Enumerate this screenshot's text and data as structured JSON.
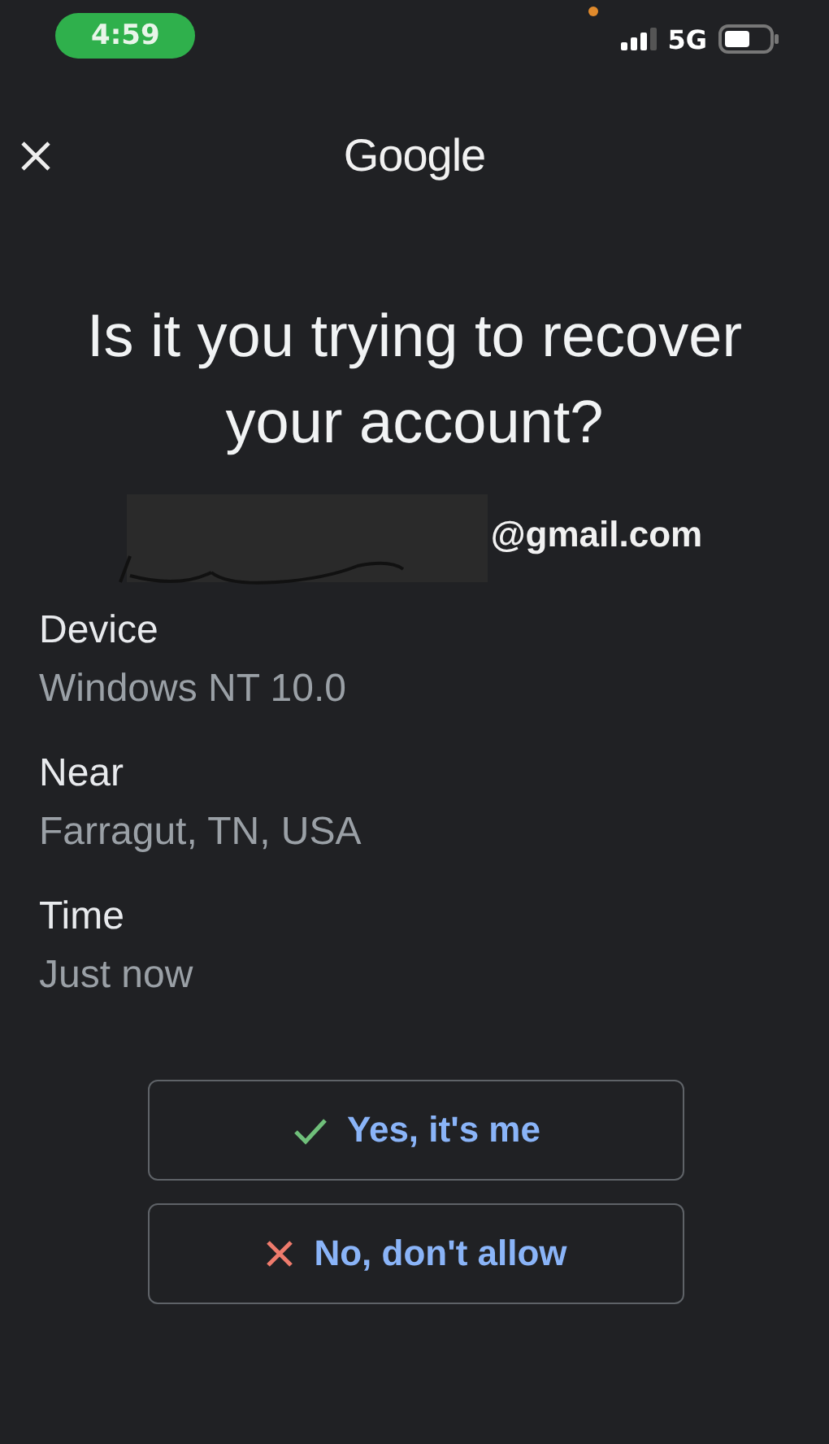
{
  "status_bar": {
    "time": "4:59",
    "network": "5G"
  },
  "header": {
    "title": "Google"
  },
  "heading": "Is it you trying to recover your account?",
  "account": {
    "email": "@gmail.com"
  },
  "details": [
    {
      "label": "Device",
      "value": "Windows NT 10.0"
    },
    {
      "label": "Near",
      "value": "Farragut, TN, USA"
    },
    {
      "label": "Time",
      "value": "Just now"
    }
  ],
  "buttons": [
    {
      "kind": "confirm",
      "label": "Yes, it's me"
    },
    {
      "kind": "deny",
      "label": "No, don't allow"
    }
  ]
}
